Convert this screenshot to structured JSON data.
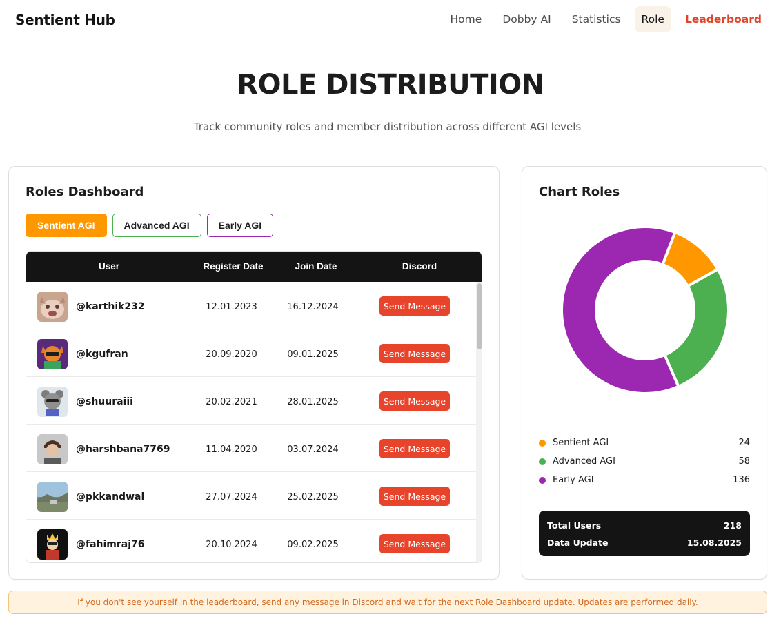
{
  "header": {
    "brand": "Sentient Hub",
    "nav": [
      "Home",
      "Dobby AI",
      "Statistics",
      "Role",
      "Leaderboard"
    ],
    "active": "Role"
  },
  "hero": {
    "title": "ROLE DISTRIBUTION",
    "subtitle": "Track community roles and member distribution across different AGI levels"
  },
  "dashboard": {
    "title": "Roles Dashboard",
    "filters": [
      "Sentient AGI",
      "Advanced AGI",
      "Early AGI"
    ],
    "columns": [
      "User",
      "Register Date",
      "Join Date",
      "Discord"
    ],
    "send_label": "Send Message",
    "rows": [
      {
        "user": "@karthik232",
        "register": "12.01.2023",
        "join": "16.12.2024"
      },
      {
        "user": "@kgufran",
        "register": "20.09.2020",
        "join": "09.01.2025"
      },
      {
        "user": "@shuuraiii",
        "register": "20.02.2021",
        "join": "28.01.2025"
      },
      {
        "user": "@harshbana7769",
        "register": "11.04.2020",
        "join": "03.07.2024"
      },
      {
        "user": "@pkkandwal",
        "register": "27.07.2024",
        "join": "25.02.2025"
      },
      {
        "user": "@fahimraj76",
        "register": "20.10.2024",
        "join": "09.02.2025"
      }
    ]
  },
  "chart_panel": {
    "title": "Chart Roles",
    "totals": {
      "users_label": "Total Users",
      "users_value": "218",
      "update_label": "Data Update",
      "update_value": "15.08.2025"
    }
  },
  "chart_data": {
    "type": "pie",
    "donut": true,
    "labels": [
      "Sentient AGI",
      "Advanced AGI",
      "Early AGI"
    ],
    "values": [
      24,
      58,
      136
    ],
    "colors": [
      "#ff9800",
      "#4caf50",
      "#9c27b0"
    ]
  },
  "notice": "If you don't see yourself in the leaderboard, send any message in Discord and wait for the next Role Dashboard update. Updates are performed daily.",
  "colors": {
    "accent": "#e8442b",
    "sentient": "#ff9800",
    "advanced": "#4caf50",
    "early": "#9c27b0",
    "dark": "#141414"
  }
}
